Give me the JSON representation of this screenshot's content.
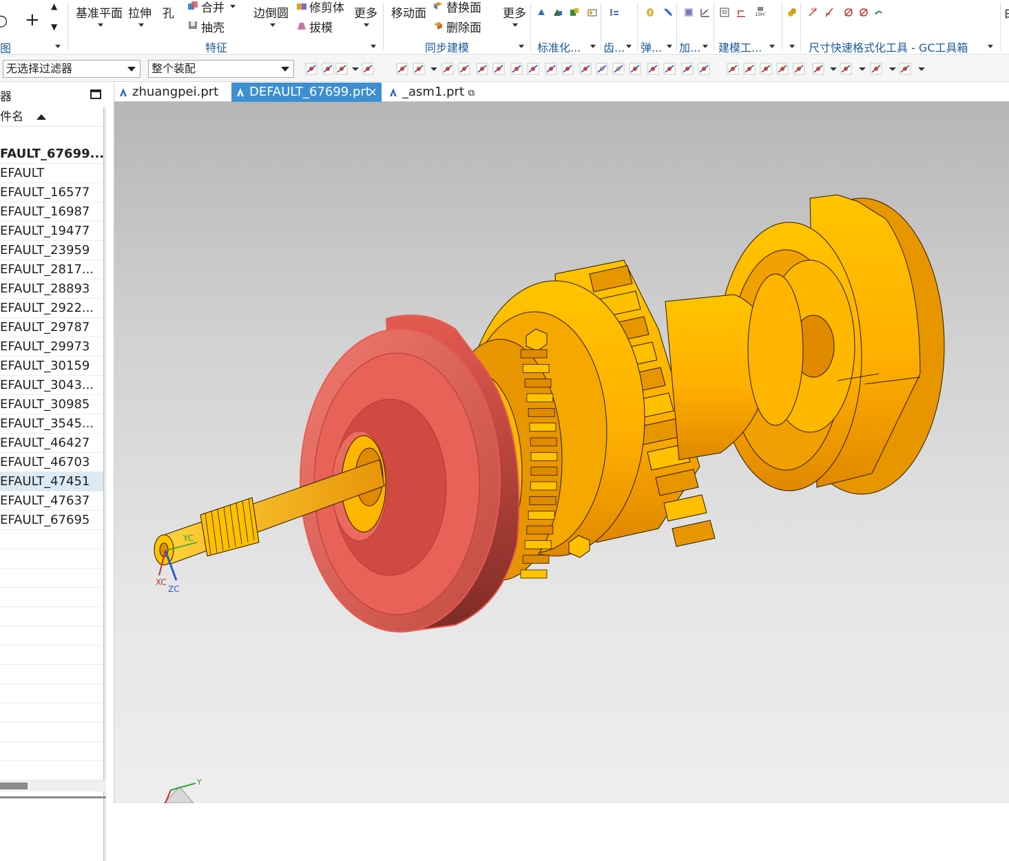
{
  "ribbon": {
    "items": {
      "datum_plane": "基准平面",
      "extrude": "拉伸",
      "hole": "孔",
      "unite": "合并",
      "shell": "抽壳",
      "edge_blend": "边倒圆",
      "trim_body": "修剪体",
      "draft": "拔模",
      "more1": "更多",
      "move_face": "移动面",
      "replace_face": "替换面",
      "delete_face": "删除面",
      "more2": "更多"
    },
    "left_partial": "图",
    "right_partial": "由",
    "groups": {
      "feature": "特征",
      "sync_modeling": "同步建模",
      "standardize": "标准化...",
      "gear": "齿...",
      "spring": "弹...",
      "machining": "加...",
      "modeling_tools": "建模工...",
      "dim_tool": "尺寸快速格式化工具 - GC工具箱"
    }
  },
  "selection_bar": {
    "filter": "无选择过滤器",
    "scope": "整个装配"
  },
  "navigator": {
    "title": "器",
    "column_header": "件名",
    "rows": [
      {
        "label": "FAULT_67699...",
        "root": true
      },
      {
        "label": "EFAULT"
      },
      {
        "label": "EFAULT_16577"
      },
      {
        "label": "EFAULT_16987"
      },
      {
        "label": "EFAULT_19477"
      },
      {
        "label": "EFAULT_23959"
      },
      {
        "label": "EFAULT_2817..."
      },
      {
        "label": "EFAULT_28893"
      },
      {
        "label": "EFAULT_2922..."
      },
      {
        "label": "EFAULT_29787"
      },
      {
        "label": "EFAULT_29973"
      },
      {
        "label": "EFAULT_30159"
      },
      {
        "label": "EFAULT_3043..."
      },
      {
        "label": "EFAULT_30985"
      },
      {
        "label": "EFAULT_3545..."
      },
      {
        "label": "EFAULT_46427"
      },
      {
        "label": "EFAULT_46703"
      },
      {
        "label": "EFAULT_47451",
        "selected": true
      },
      {
        "label": "EFAULT_47637"
      },
      {
        "label": "EFAULT_67695"
      },
      {
        "label": ""
      },
      {
        "label": ""
      },
      {
        "label": ""
      },
      {
        "label": ""
      },
      {
        "label": ""
      },
      {
        "label": ""
      },
      {
        "label": ""
      },
      {
        "label": ""
      },
      {
        "label": ""
      },
      {
        "label": ""
      },
      {
        "label": ""
      },
      {
        "label": ""
      },
      {
        "label": ""
      }
    ]
  },
  "tabs": [
    {
      "label": "zhuangpei.prt",
      "active": false
    },
    {
      "label": "DEFAULT_67699.prt",
      "active": true,
      "close": "×"
    },
    {
      "label": "_asm1.prt",
      "active": false,
      "marker": "⧉"
    }
  ],
  "viewport": {
    "wcs": {
      "x": "XC",
      "y": "YC",
      "z": "ZC"
    },
    "triad": {
      "y": "Y"
    },
    "colors": {
      "part": "#FFB800",
      "part_dark": "#E08A00",
      "selected": "#E05A50",
      "selected_dark": "#8E302A"
    }
  }
}
